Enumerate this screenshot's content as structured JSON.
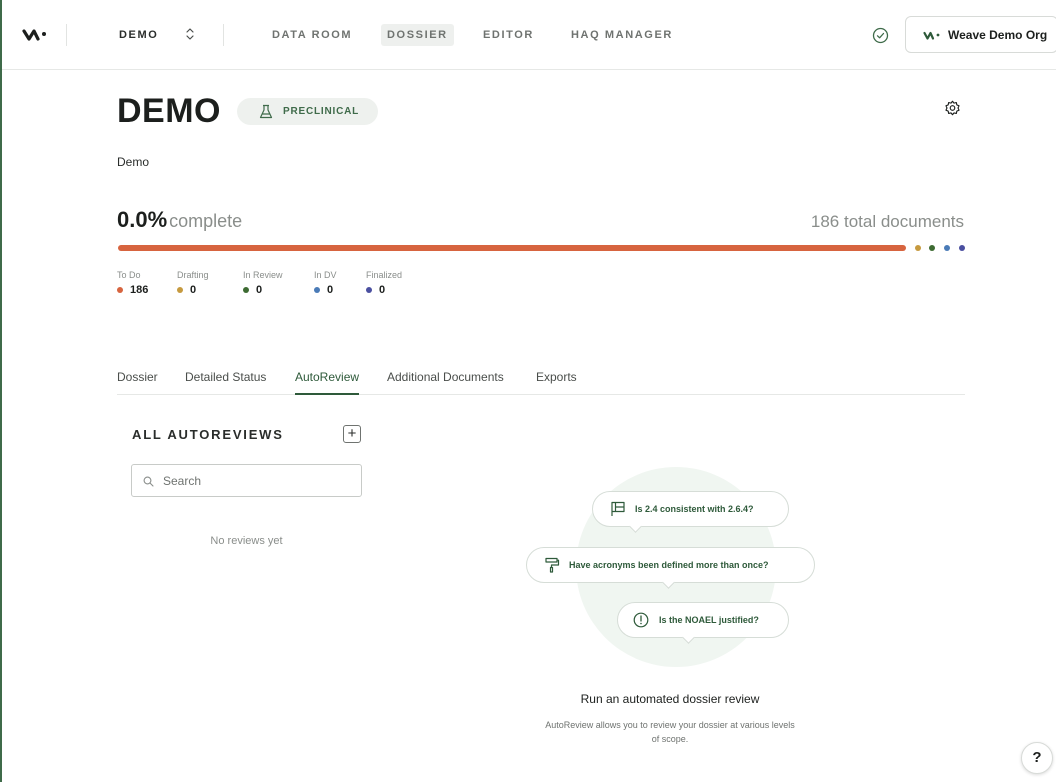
{
  "nav": {
    "project": "DEMO",
    "items": [
      {
        "label": "DATA ROOM",
        "active": false
      },
      {
        "label": "DOSSIER",
        "active": true
      },
      {
        "label": "EDITOR",
        "active": false
      },
      {
        "label": "HAQ MANAGER",
        "active": false
      }
    ],
    "org_label": "Weave Demo Org",
    "icons": {
      "logo": "weave-logo-icon",
      "sync": "check-circle-icon",
      "chevron": "chevron-up-down-icon"
    }
  },
  "header": {
    "title": "DEMO",
    "stage": "PRECLINICAL",
    "stage_icon": "flask-icon",
    "description": "Demo",
    "settings_icon": "gear-icon"
  },
  "progress": {
    "percent": "0.0%",
    "complete_label": "complete",
    "total_label": "186 total documents",
    "fraction_complete": 0.0,
    "stats": [
      {
        "label": "To Do",
        "value": "186",
        "color": "#d7643f"
      },
      {
        "label": "Drafting",
        "value": "0",
        "color": "#c69a3f"
      },
      {
        "label": "In Review",
        "value": "0",
        "color": "#3d6b32"
      },
      {
        "label": "In DV",
        "value": "0",
        "color": "#4a7bb7"
      },
      {
        "label": "Finalized",
        "value": "0",
        "color": "#4a4fa0"
      }
    ]
  },
  "tabs": [
    {
      "label": "Dossier",
      "active": false
    },
    {
      "label": "Detailed Status",
      "active": false
    },
    {
      "label": "AutoReview",
      "active": true
    },
    {
      "label": "Additional Documents",
      "active": false
    },
    {
      "label": "Exports",
      "active": false
    }
  ],
  "autoreviews": {
    "title": "ALL AUTOREVIEWS",
    "add_label": "+",
    "search_placeholder": "Search",
    "search_value": "",
    "empty_message": "No reviews yet"
  },
  "illustration": {
    "bubbles": [
      {
        "text": "Is 2.4 consistent with 2.6.4?",
        "icon": "flag-icon"
      },
      {
        "text": "Have acronyms been defined more than once?",
        "icon": "paint-roller-icon"
      },
      {
        "text": "Is the NOAEL justified?",
        "icon": "alert-circle-icon"
      }
    ],
    "cta_title": "Run an automated dossier review",
    "cta_desc": "AutoReview allows you to review your dossier at various levels of scope."
  },
  "help_label": "?",
  "colors": {
    "accent": "#2e5a3a",
    "todo": "#d7643f"
  }
}
